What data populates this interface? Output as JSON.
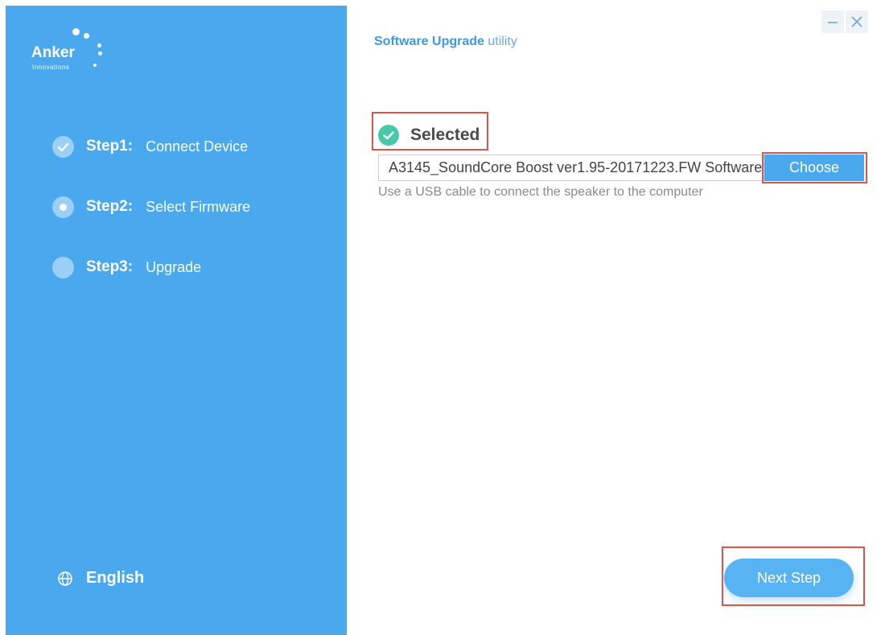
{
  "logo": {
    "word": "Anker",
    "sub": "Innovations"
  },
  "sidebar": {
    "steps": [
      {
        "num": "Step1:",
        "label": "Connect Device",
        "state": "done"
      },
      {
        "num": "Step2:",
        "label": "Select Firmware",
        "state": "current"
      },
      {
        "num": "Step3:",
        "label": "Upgrade",
        "state": "pending"
      }
    ],
    "language": "English"
  },
  "header": {
    "title_bold": "Software Upgrade",
    "title_normal": "utility"
  },
  "main": {
    "status": "Selected",
    "file_value": "A3145_SoundCore Boost ver1.95-20171223.FW Software",
    "choose_label": "Choose",
    "hint": "Use a USB cable to connect the speaker to the computer",
    "next_label": "Next Step"
  },
  "colors": {
    "sidebar": "#4aa8ee",
    "accent": "#4aa8ee",
    "success": "#48c9a5",
    "highlight": "#e0534a"
  },
  "icons": [
    "check-icon",
    "globe-icon",
    "minimize-icon",
    "close-icon"
  ]
}
